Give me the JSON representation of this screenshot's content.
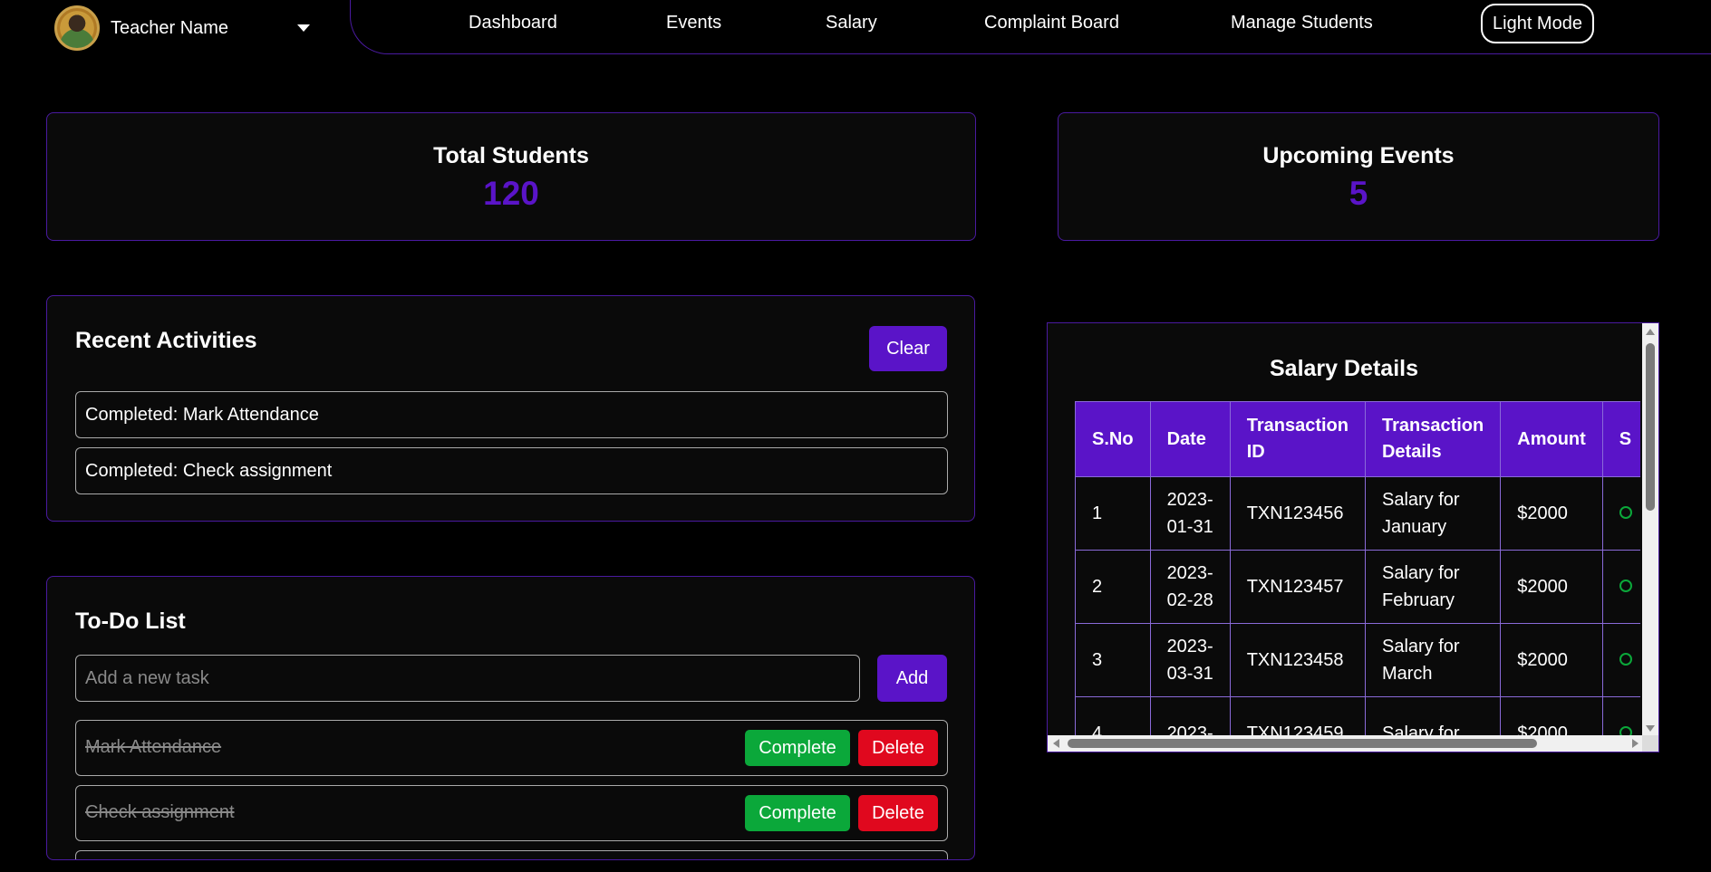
{
  "profile": {
    "name": "Teacher Name"
  },
  "nav": {
    "items": [
      "Dashboard",
      "Events",
      "Salary",
      "Complaint Board",
      "Manage Students"
    ],
    "mode_button": "Light Mode"
  },
  "stats": {
    "students": {
      "title": "Total Students",
      "value": "120"
    },
    "events": {
      "title": "Upcoming Events",
      "value": "5"
    }
  },
  "activities": {
    "title": "Recent Activities",
    "clear_label": "Clear",
    "items": [
      "Completed: Mark Attendance",
      "Completed: Check assignment"
    ]
  },
  "todo": {
    "title": "To-Do List",
    "placeholder": "Add a new task",
    "add_label": "Add",
    "complete_label": "Complete",
    "delete_label": "Delete",
    "items": [
      "Mark Attendance",
      "Check assignment"
    ]
  },
  "salary": {
    "title": "Salary Details",
    "columns": [
      "S.No",
      "Date",
      "Transaction ID",
      "Transaction Details",
      "Amount",
      "S"
    ],
    "rows": [
      [
        "1",
        "2023-01-31",
        "TXN123456",
        "Salary for January",
        "$2000"
      ],
      [
        "2",
        "2023-02-28",
        "TXN123457",
        "Salary for February",
        "$2000"
      ],
      [
        "3",
        "2023-03-31",
        "TXN123458",
        "Salary for March",
        "$2000"
      ],
      [
        "4",
        "2023-",
        "TXN123459",
        "Salary for",
        "$2000"
      ]
    ]
  },
  "colors": {
    "accent": "#5a14c8",
    "complete": "#0ba83a",
    "delete": "#e0081e",
    "border": "#4a1aa0"
  }
}
